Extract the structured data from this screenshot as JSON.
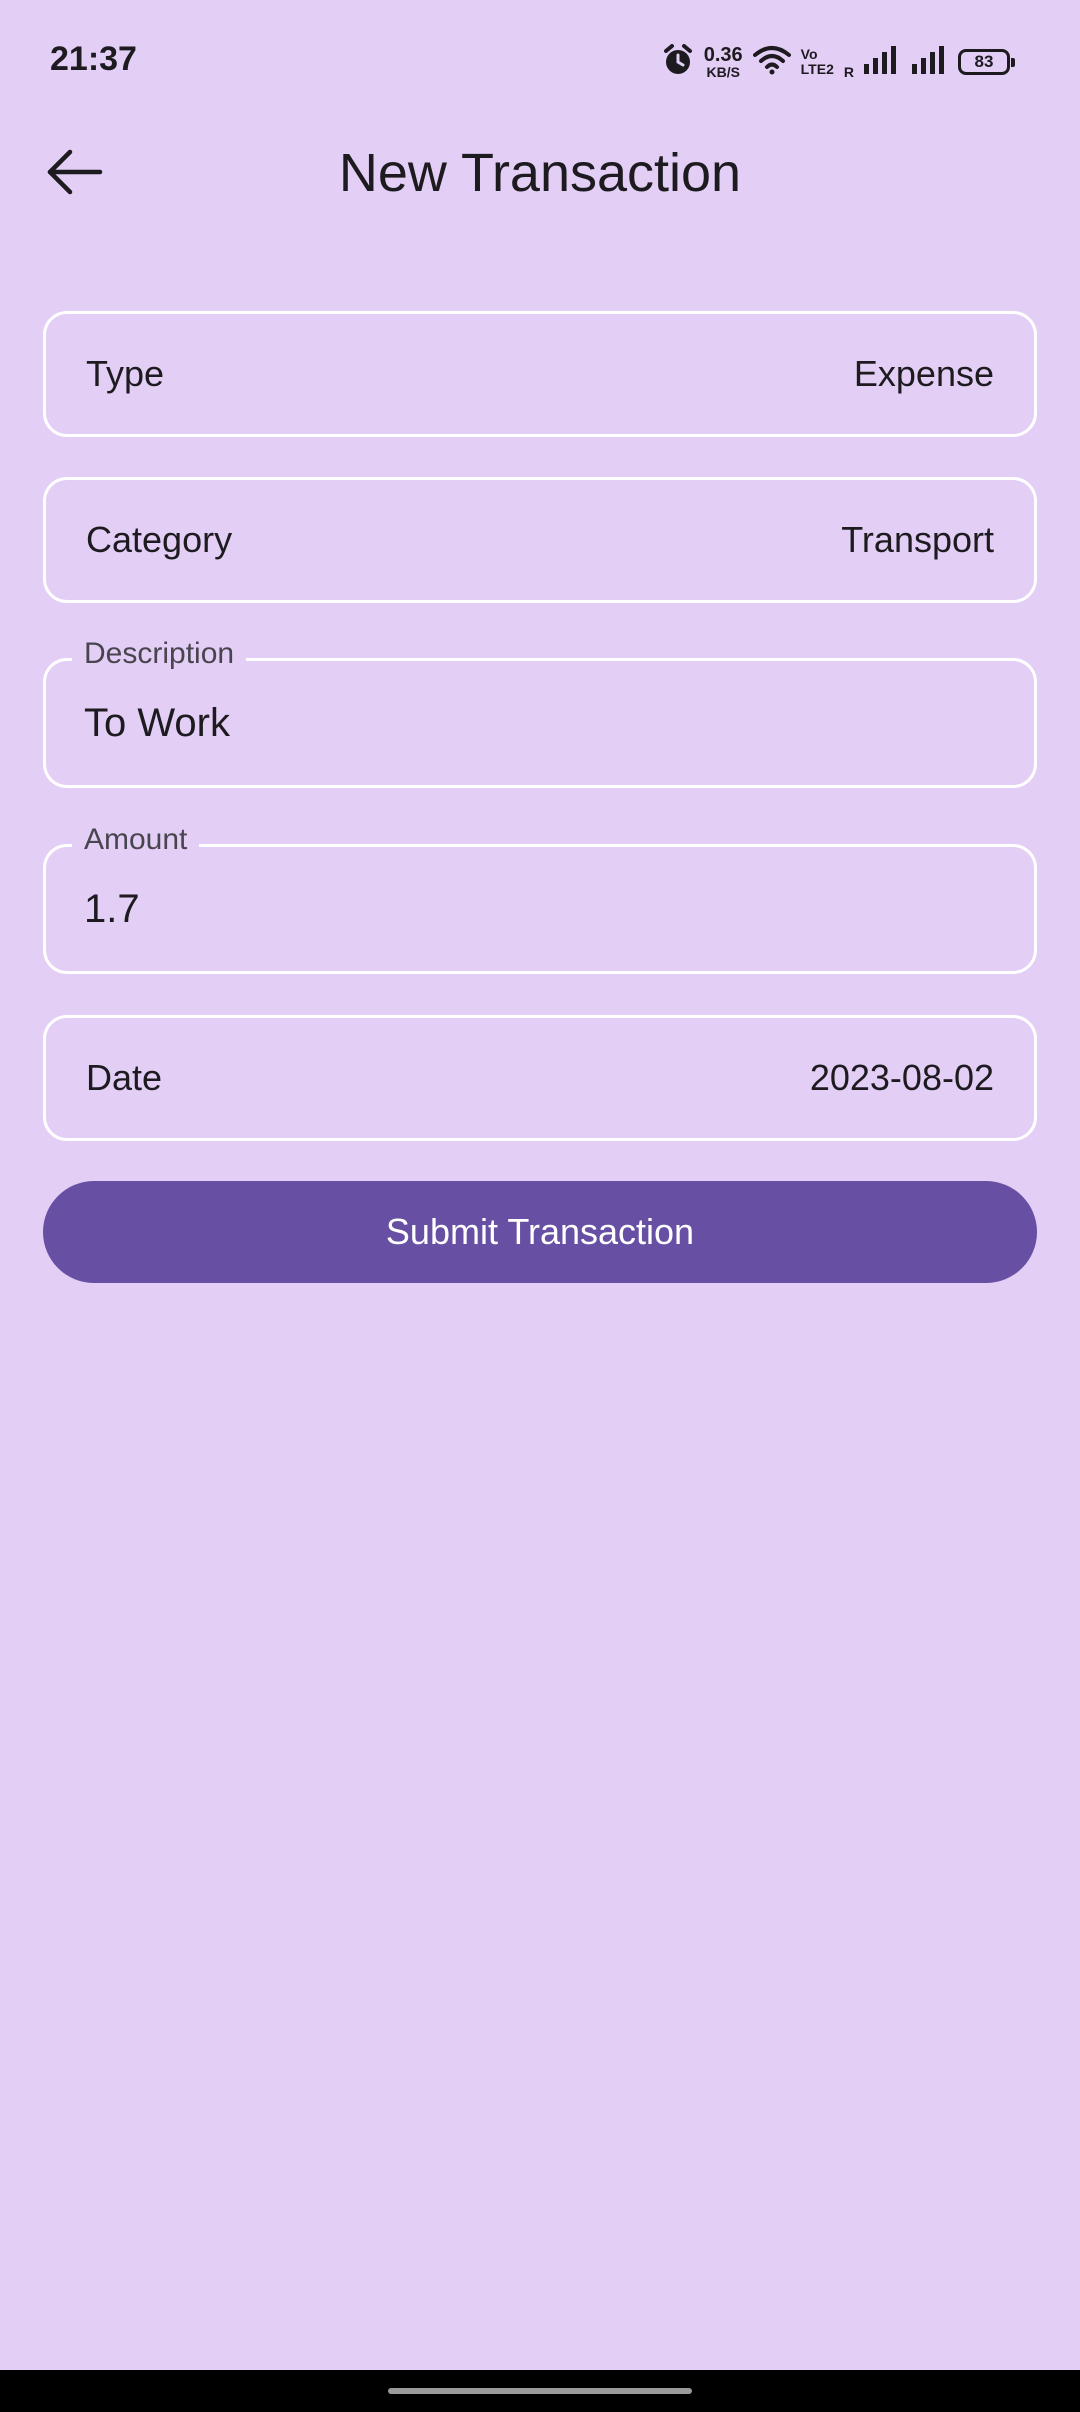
{
  "status_bar": {
    "time": "21:37",
    "net_speed_value": "0.36",
    "net_speed_unit": "KB/S",
    "volte_top": "Vo",
    "volte_bottom": "LTE2",
    "roaming": "R",
    "battery": "83",
    "icons": [
      "alarm-icon",
      "wifi-icon",
      "signal-icon",
      "signal-icon",
      "battery-icon"
    ]
  },
  "app_bar": {
    "title": "New Transaction",
    "back_icon": "arrow-left-icon"
  },
  "form": {
    "type": {
      "label": "Type",
      "value": "Expense"
    },
    "category": {
      "label": "Category",
      "value": "Transport"
    },
    "description": {
      "label": "Description",
      "value": "To Work"
    },
    "amount": {
      "label": "Amount",
      "value": "1.7"
    },
    "date": {
      "label": "Date",
      "value": "2023-08-02"
    }
  },
  "submit": {
    "label": "Submit Transaction"
  },
  "colors": {
    "background": "#e3cef5",
    "primary": "#6750a4",
    "outline": "#ffffff",
    "text": "#1d1b20"
  }
}
